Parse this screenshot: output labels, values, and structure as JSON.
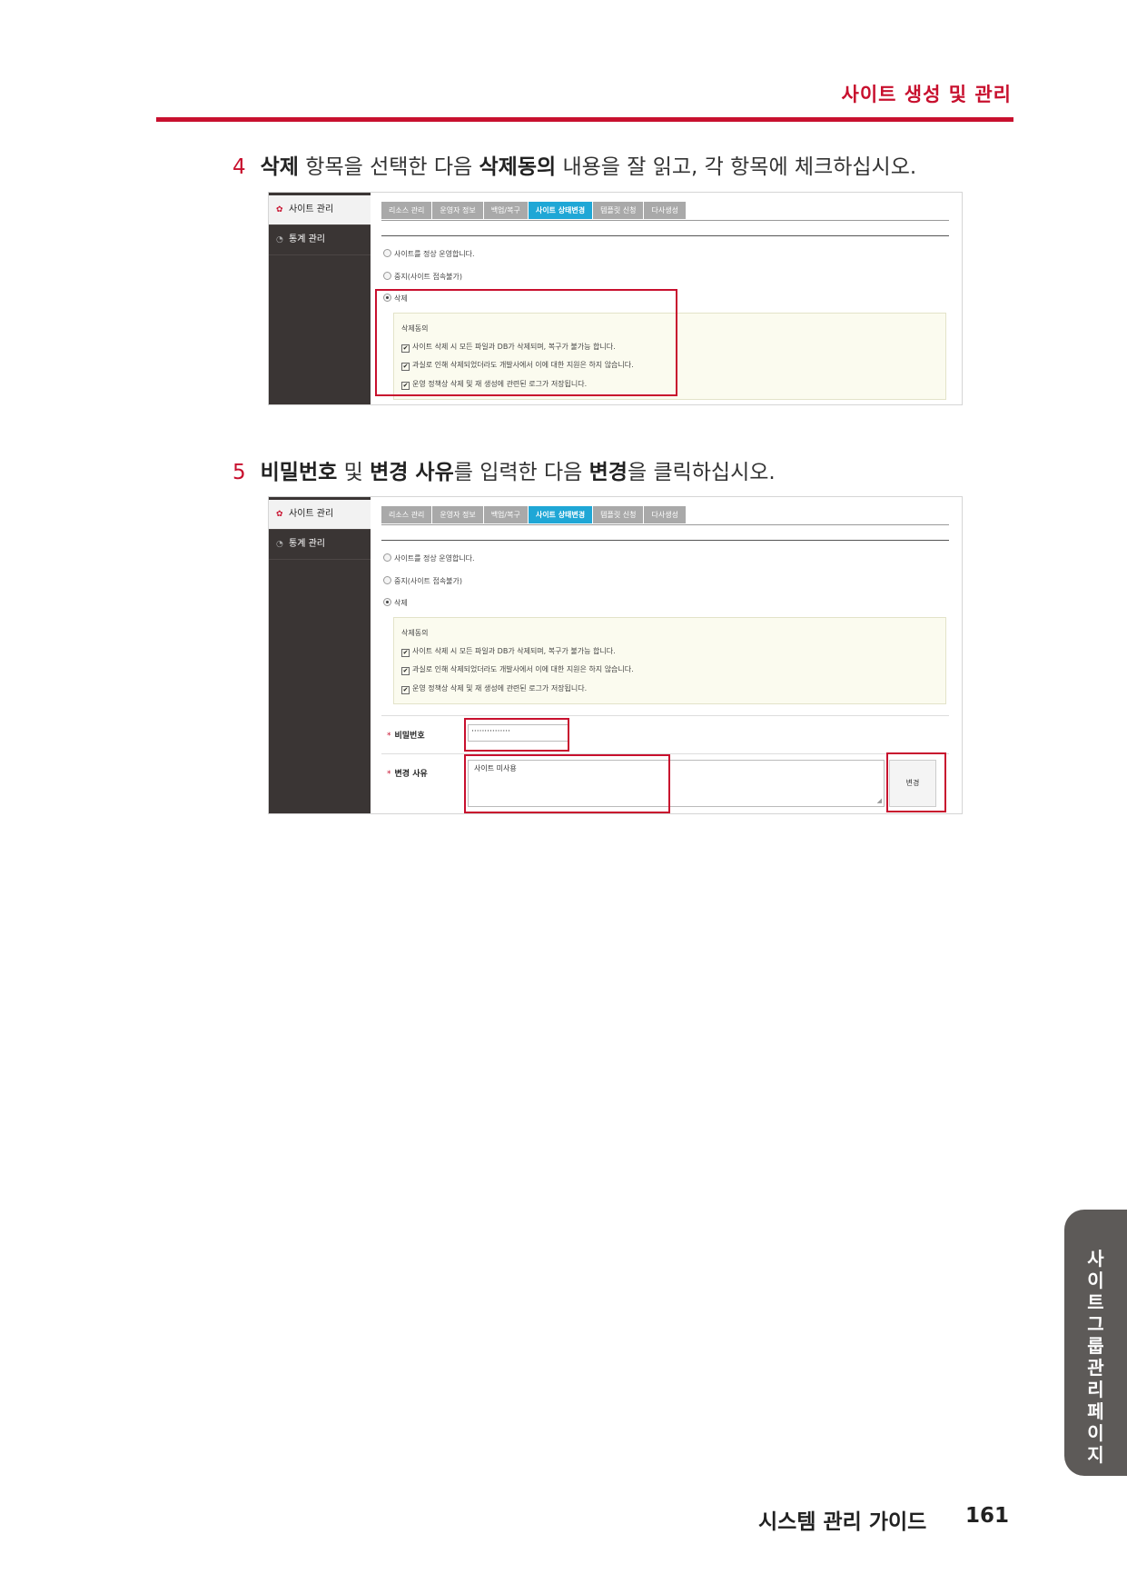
{
  "header": {
    "title": "사이트 생성 및 관리"
  },
  "steps": [
    {
      "num": "4",
      "b1": "삭제",
      "t1": " 항목을 선택한 다음 ",
      "b2": "삭제동의",
      "t2": " 내용을 잘 읽고, 각 항목에 체크하십시오."
    },
    {
      "num": "5",
      "b1": "비밀번호",
      "t1": " 및 ",
      "b2": "변경 사유",
      "t2": "를 입력한 다음 ",
      "b3": "변경",
      "t3": "을 클릭하십시오."
    }
  ],
  "ui": {
    "sidebar": [
      {
        "label": "사이트 관리",
        "icon": "gear-icon",
        "active": true
      },
      {
        "label": "통계 관리",
        "icon": "chart-icon",
        "active": false
      }
    ],
    "tabs": [
      "리소스 관리",
      "운영자 정보",
      "백업/복구",
      "사이트 상태변경",
      "템플릿 신청",
      "다사생성"
    ],
    "active_tab": "사이트 상태변경",
    "radios": [
      "사이트를 정상 운영합니다.",
      "중지(사이트 접속불가)",
      "삭제"
    ],
    "agree_title": "삭제동의",
    "agree_items": [
      "사이트 삭제 시 모든 파일과 DB가 삭제되며, 복구가 불가능 합니다.",
      "과실로 인해 삭제되었더라도 개발사에서 이에 대한 지원은 하지 않습니다.",
      "운영 정책상 삭제 및 재 생성에 관련된 로그가 저장됩니다."
    ],
    "form": {
      "required_mark": "*",
      "password_label": "비밀번호",
      "password_value": "···············",
      "reason_label": "변경 사유",
      "reason_value": "사이트 미사용",
      "submit_label": "변경"
    }
  },
  "side_tab": {
    "text": "사이트그룹 관리페이지"
  },
  "footer": {
    "title": "시스템 관리 가이드",
    "page": "161"
  }
}
